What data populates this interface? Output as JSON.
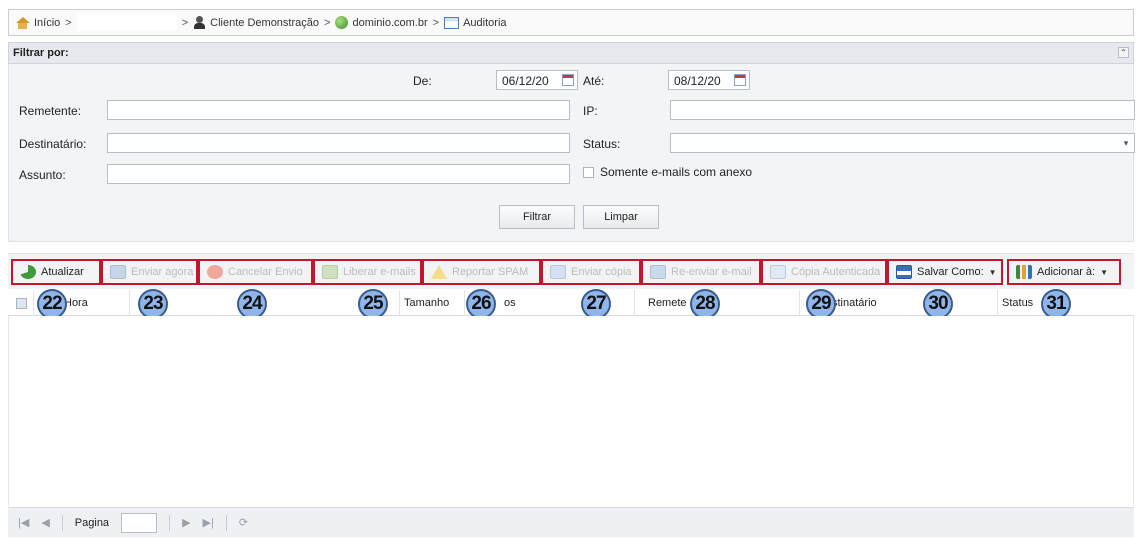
{
  "breadcrumb": {
    "home": "Início",
    "sep": ">",
    "client": "Cliente Demonstração",
    "domain": "dominio.com.br",
    "page": "Auditoria"
  },
  "filter": {
    "title": "Filtrar por:",
    "de_label": "De:",
    "de_value": "06/12/20",
    "ate_label": "Até:",
    "ate_value": "08/12/20",
    "remetente_label": "Remetente:",
    "ip_label": "IP:",
    "destinatario_label": "Destinatário:",
    "status_label": "Status:",
    "assunto_label": "Assunto:",
    "attachment_label": "Somente e-mails com anexo",
    "filtrar_button": "Filtrar",
    "limpar_button": "Limpar"
  },
  "toolbar": {
    "atualizar": "Atualizar",
    "enviar_agora": "Enviar agora",
    "cancelar_envio": "Cancelar Envio",
    "liberar_emails": "Liberar e-mails",
    "reportar_spam": "Reportar SPAM",
    "enviar_copia": "Enviar cópia",
    "reenviar_email": "Re-enviar e-mail",
    "copia_autenticada": "Cópia Autenticada",
    "salvar_como": "Salvar Como:",
    "adicionar_a": "Adicionar à:"
  },
  "grid": {
    "columns": {
      "hora": "Hora",
      "col2": "o",
      "tamanho": "Tamanho",
      "col5": "os",
      "remetente": "Remete",
      "destinatario": "stinatário",
      "status": "Status"
    }
  },
  "markers": [
    "22",
    "23",
    "24",
    "25",
    "26",
    "27",
    "28",
    "29",
    "30",
    "31"
  ],
  "pager": {
    "page_label": "Pagina"
  }
}
